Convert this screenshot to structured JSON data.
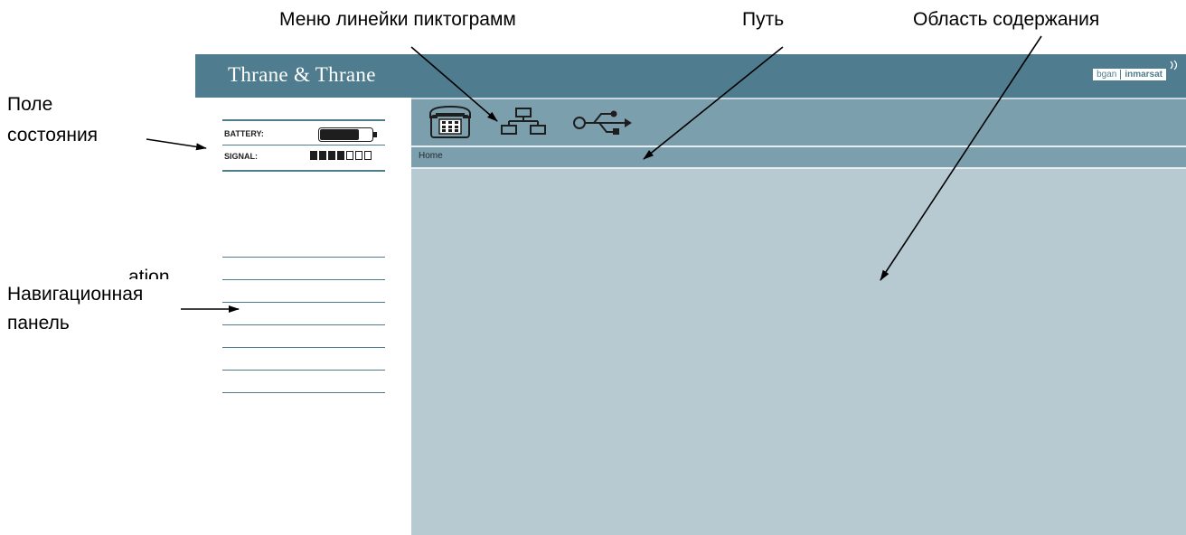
{
  "callouts": {
    "icon_bar_menu": "Меню линейки пиктограмм",
    "path": "Путь",
    "content_area": "Область содержания",
    "status_field_line1": "Поле",
    "status_field_line2": "состояния",
    "navigation_panel_line1": "Навигационная",
    "navigation_panel_line2": "панель",
    "nav_text_fragment": "ation"
  },
  "header": {
    "brand": "Thrane & Thrane",
    "partner_left": "bgan",
    "partner_right": "inmarsat"
  },
  "status": {
    "battery_label": "BATTERY:",
    "signal_label": "SIGNAL:",
    "battery_level": 0.75,
    "signal_bars_filled": 4,
    "signal_bars_total": 7
  },
  "toolbar": {
    "icons": [
      "telephone-icon",
      "network-icon",
      "usb-icon"
    ]
  },
  "breadcrumb": {
    "home": "Home"
  },
  "navigation": {
    "items": [
      "",
      "",
      "",
      "",
      "",
      "",
      ""
    ]
  },
  "colors": {
    "header": "#4f7d8f",
    "icon_bar": "#7c9fae",
    "content": "#b7cad1",
    "nav_divider": "#4f7d8f"
  }
}
